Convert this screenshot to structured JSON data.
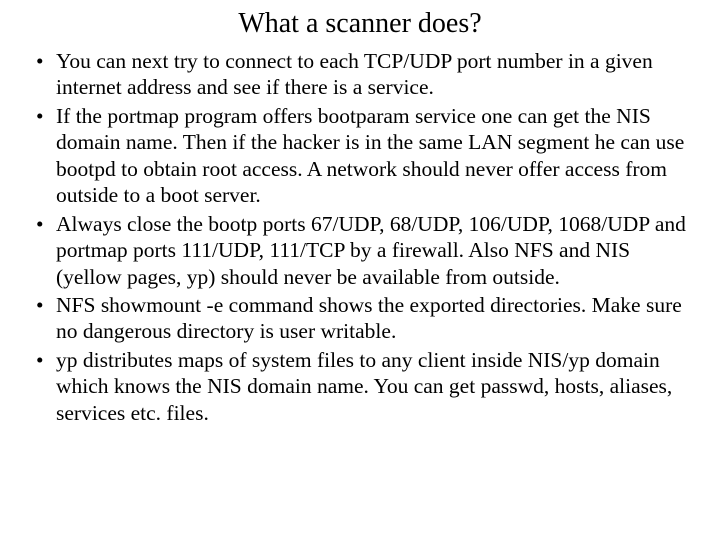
{
  "slide": {
    "title": "What a scanner does?",
    "bullets": [
      "You can next try to connect to each TCP/UDP port number in a given internet address and see if there is a service.",
      "If the portmap program offers bootparam service one can get the NIS domain name. Then if the hacker is in the same LAN segment he can use bootpd to obtain root access. A network should never offer access from outside to a boot server.",
      "Always close the bootp ports 67/UDP, 68/UDP, 106/UDP, 1068/UDP and portmap ports 111/UDP, 111/TCP by a firewall. Also NFS and NIS (yellow pages, yp) should never be available from outside.",
      "NFS showmount -e command shows the exported directories. Make sure no dangerous directory is user writable.",
      "yp distributes maps of system files to any client inside NIS/yp domain which knows the NIS domain name. You can get passwd, hosts, aliases, services etc. files."
    ]
  }
}
